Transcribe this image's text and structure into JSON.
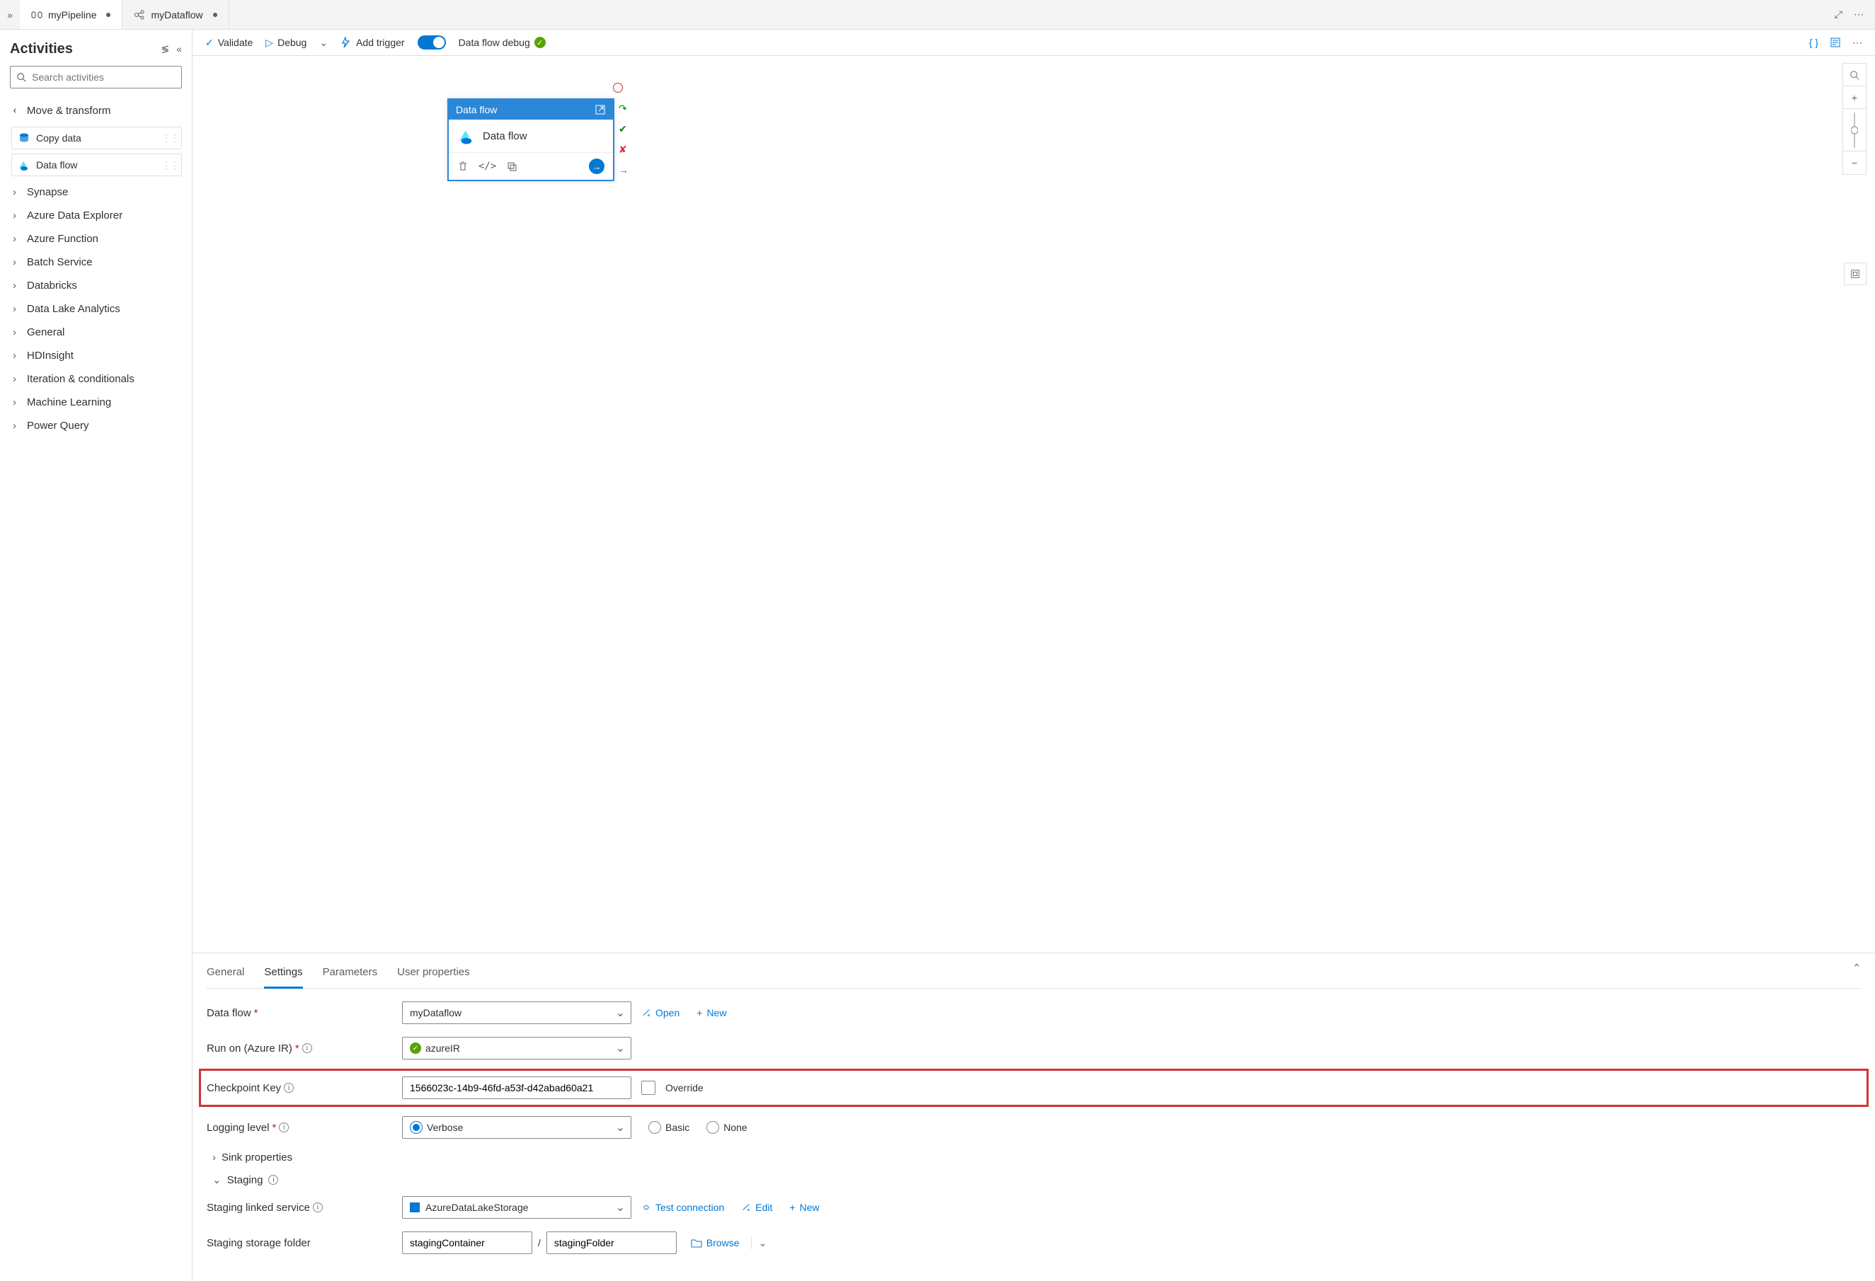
{
  "tabs": [
    {
      "label": "myPipeline",
      "icon": "pipeline",
      "dirty": true,
      "active": true
    },
    {
      "label": "myDataflow",
      "icon": "dataflow",
      "dirty": true,
      "active": false
    }
  ],
  "sidebar": {
    "title": "Activities",
    "search_placeholder": "Search activities",
    "categories": [
      {
        "label": "Move & transform",
        "expanded": true,
        "items": [
          {
            "label": "Copy data",
            "icon": "copy"
          },
          {
            "label": "Data flow",
            "icon": "dataflow"
          }
        ]
      },
      {
        "label": "Synapse"
      },
      {
        "label": "Azure Data Explorer"
      },
      {
        "label": "Azure Function"
      },
      {
        "label": "Batch Service"
      },
      {
        "label": "Databricks"
      },
      {
        "label": "Data Lake Analytics"
      },
      {
        "label": "General"
      },
      {
        "label": "HDInsight"
      },
      {
        "label": "Iteration & conditionals"
      },
      {
        "label": "Machine Learning"
      },
      {
        "label": "Power Query"
      }
    ]
  },
  "toolbar": {
    "validate": "Validate",
    "debug": "Debug",
    "add_trigger": "Add trigger",
    "debug_label": "Data flow debug"
  },
  "canvas": {
    "node_type": "Data flow",
    "node_name": "Data flow"
  },
  "panel": {
    "tabs": [
      "General",
      "Settings",
      "Parameters",
      "User properties"
    ],
    "active_tab": 1,
    "fields": {
      "dataflow_label": "Data flow",
      "dataflow_value": "myDataflow",
      "open": "Open",
      "new": "New",
      "runon_label": "Run on (Azure IR)",
      "runon_value": "azureIR",
      "checkpoint_label": "Checkpoint Key",
      "checkpoint_value": "1566023c-14b9-46fd-a53f-d42abad60a21",
      "override": "Override",
      "logging_label": "Logging level",
      "logging_options": [
        "Verbose",
        "Basic",
        "None"
      ],
      "logging_selected": 0,
      "sink_props": "Sink properties",
      "staging": "Staging",
      "staging_ls_label": "Staging linked service",
      "staging_ls_value": "AzureDataLakeStorage",
      "test_conn": "Test connection",
      "edit": "Edit",
      "staging_folder_label": "Staging storage folder",
      "staging_container": "stagingContainer",
      "staging_folder": "stagingFolder",
      "browse": "Browse"
    }
  }
}
